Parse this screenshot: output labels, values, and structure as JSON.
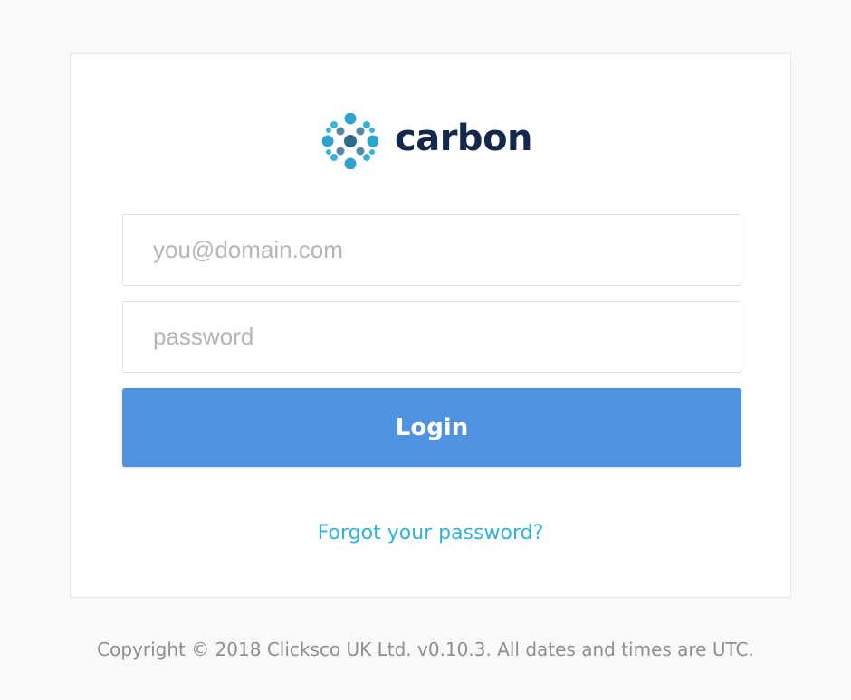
{
  "logo": {
    "text": "carbon",
    "icon": "carbon-dots-icon",
    "dot_colors": [
      "#2fa3cf",
      "#5a87a6",
      "#2d6a8c"
    ]
  },
  "form": {
    "email": {
      "placeholder": "you@domain.com",
      "value": ""
    },
    "password": {
      "placeholder": "password",
      "value": ""
    },
    "login_label": "Login",
    "forgot_label": "Forgot your password?"
  },
  "footer": {
    "text": "Copyright © 2018 Clicksco UK Ltd. v0.10.3. All dates and times are UTC."
  },
  "colors": {
    "primary": "#4f92e0",
    "link": "#33b3d9",
    "brand_text": "#13284b"
  }
}
